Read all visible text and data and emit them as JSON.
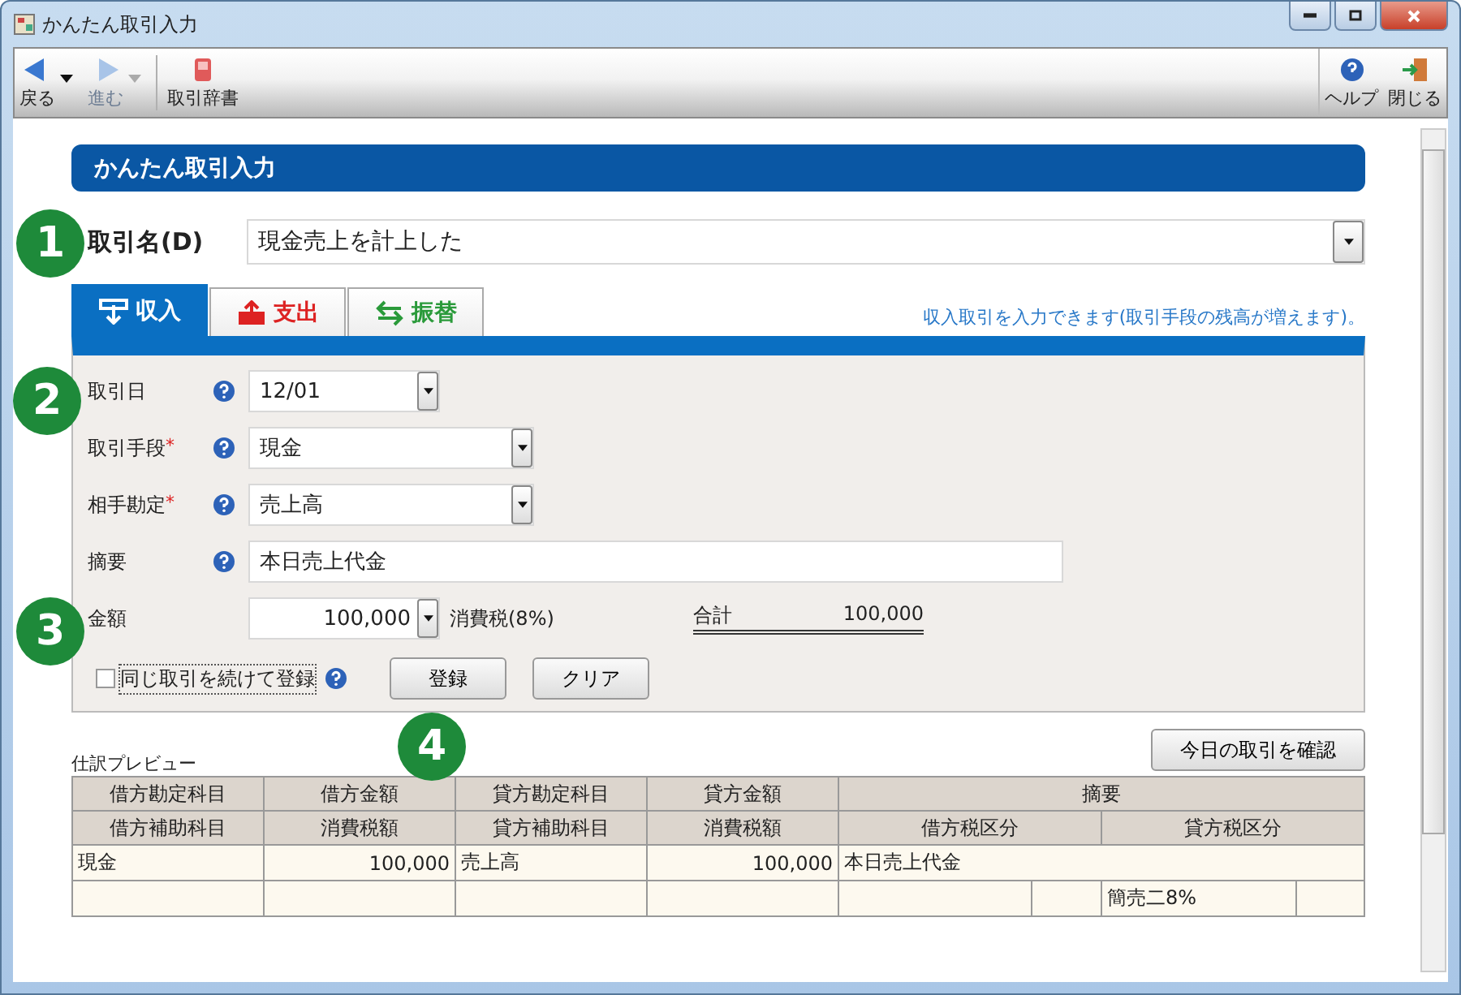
{
  "window": {
    "title": "かんたん取引入力"
  },
  "toolbar": {
    "left": [
      {
        "label": "戻る",
        "kind": "back",
        "disabled": false,
        "dropdown": true
      },
      {
        "label": "進む",
        "kind": "forward",
        "disabled": true,
        "dropdown": true
      },
      {
        "label": "取引辞書",
        "kind": "dictionary",
        "disabled": false,
        "dropdown": false
      }
    ],
    "right": [
      {
        "label": "ヘルプ",
        "kind": "help",
        "disabled": false,
        "dropdown": false
      },
      {
        "label": "閉じる",
        "kind": "exit",
        "disabled": false,
        "dropdown": false
      }
    ]
  },
  "header": "かんたん取引入力",
  "transaction_name": {
    "label": "取引名(D)",
    "value": "現金売上を計上した"
  },
  "tabs": [
    {
      "label": "収入",
      "kind": "income",
      "selected": true
    },
    {
      "label": "支出",
      "kind": "expense",
      "selected": false
    },
    {
      "label": "振替",
      "kind": "transfer",
      "selected": false
    }
  ],
  "tab_hint": "収入取引を入力できます(取引手段の残高が増えます)。",
  "fields": [
    {
      "label": "取引日",
      "kind": "short-select",
      "value": "12/01"
    },
    {
      "label": "取引手段",
      "required_mark": "*",
      "kind": "select",
      "value": "現金"
    },
    {
      "label": "相手勘定",
      "required_mark": "*",
      "kind": "select",
      "value": "売上高"
    },
    {
      "label": "摘要",
      "kind": "text",
      "value": "本日売上代金"
    }
  ],
  "amount": {
    "label": "金額",
    "value": "100,000",
    "tax_label": "消費税(8%)"
  },
  "total": {
    "label": "合計",
    "value": "100,000"
  },
  "continue_checkbox": {
    "label": "同じ取引を続けて登録",
    "checked": false
  },
  "buttons": [
    "登録",
    "クリア"
  ],
  "preview": {
    "title": "仕訳プレビュー",
    "confirm_button": "今日の取引を確認",
    "header_top": [
      "借方勘定科目",
      "借方金額",
      "貸方勘定科目",
      "貸方金額",
      "摘要"
    ],
    "header_bottom": [
      "借方補助科目",
      "消費税額",
      "貸方補助科目",
      "消費税額",
      "借方税区分",
      "貸方税区分"
    ],
    "entries": [
      {
        "debit_account": "現金",
        "debit_amount": "100,000",
        "credit_account": "売上高",
        "credit_amount": "100,000",
        "memo": "本日売上代金",
        "credit_tax_class": "簡売二8%"
      }
    ]
  },
  "callouts": [
    "1",
    "2",
    "3",
    "4"
  ]
}
